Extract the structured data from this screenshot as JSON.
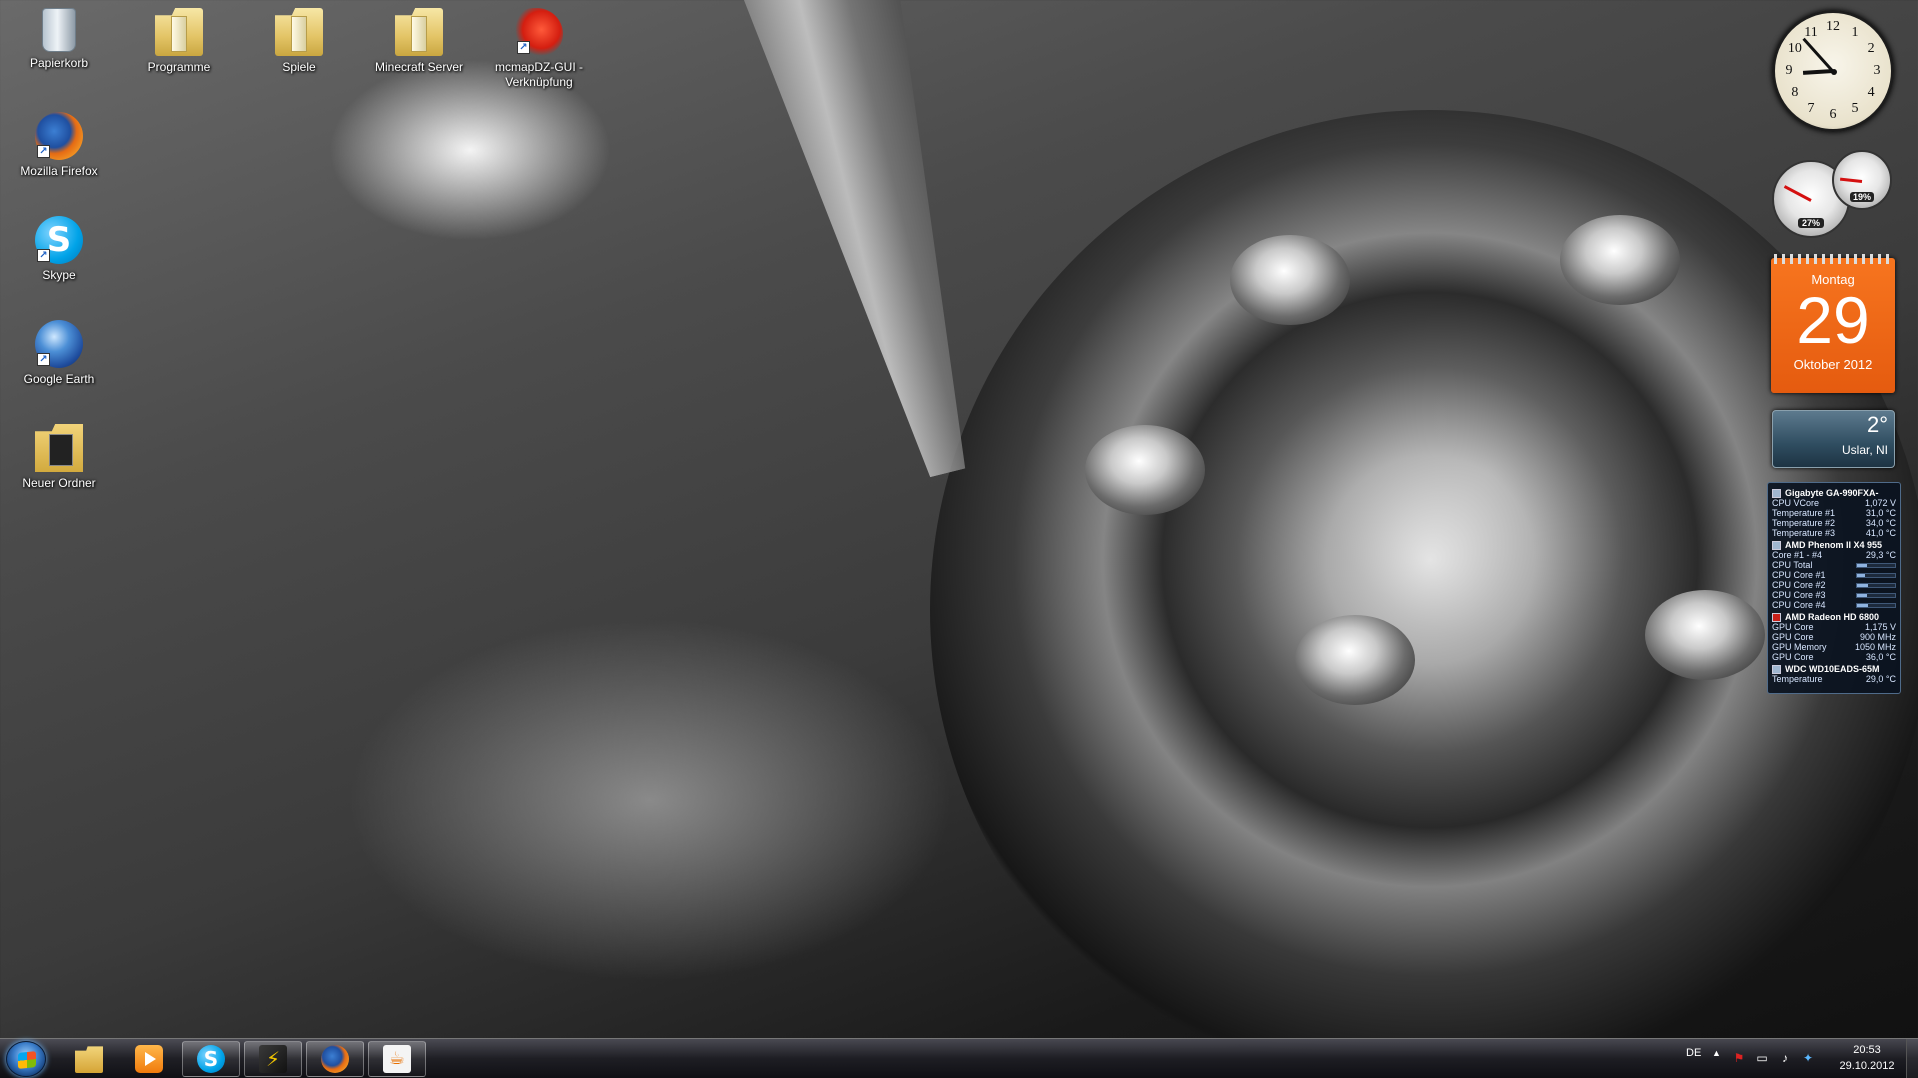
{
  "desktop": {
    "icons": [
      {
        "label": "Papierkorb",
        "icon": "recycle-bin-icon"
      },
      {
        "label": "Programme",
        "icon": "folder-icon"
      },
      {
        "label": "Spiele",
        "icon": "folder-icon"
      },
      {
        "label": "Minecraft Server",
        "icon": "folder-icon"
      },
      {
        "label": "mcmapDZ-GUI - Verknüpfung",
        "icon": "dragon-app-icon"
      },
      {
        "label": "Mozilla Firefox",
        "icon": "firefox-icon"
      },
      {
        "label": "Skype",
        "icon": "skype-icon"
      },
      {
        "label": "Google Earth",
        "icon": "google-earth-icon"
      },
      {
        "label": "Neuer Ordner",
        "icon": "folder-icon"
      }
    ]
  },
  "gadgets": {
    "clock": {
      "numerals": [
        "12",
        "1",
        "2",
        "3",
        "4",
        "5",
        "6",
        "7",
        "8",
        "9",
        "10",
        "11"
      ],
      "hour": 8,
      "minute": 53
    },
    "cpu_meter": {
      "cpu_percent": "27%",
      "memory_percent": "19%",
      "cpu_level": 0.27,
      "memory_level": 0.19
    },
    "calendar": {
      "weekday": "Montag",
      "day": "29",
      "month_year": "Oktober 2012"
    },
    "weather": {
      "temperature": "2°",
      "location": "Uslar, NI"
    },
    "hardware_monitor": {
      "groups": [
        {
          "name": "Gigabyte GA-990FXA-",
          "vendor": "board",
          "rows": [
            {
              "label": "CPU VCore",
              "value": "1,072 V"
            },
            {
              "label": "Temperature #1",
              "value": "31,0 °C"
            },
            {
              "label": "Temperature #2",
              "value": "34,0 °C"
            },
            {
              "label": "Temperature #3",
              "value": "41,0 °C"
            }
          ]
        },
        {
          "name": "AMD Phenom II X4 955",
          "vendor": "cpu",
          "rows": [
            {
              "label": "Core #1 - #4",
              "value": "29,3 °C"
            },
            {
              "label": "CPU Total",
              "bar": 0.27
            },
            {
              "label": "CPU Core #1",
              "bar": 0.22
            },
            {
              "label": "CPU Core #2",
              "bar": 0.3
            },
            {
              "label": "CPU Core #3",
              "bar": 0.25
            },
            {
              "label": "CPU Core #4",
              "bar": 0.28
            }
          ]
        },
        {
          "name": "AMD Radeon HD 6800",
          "vendor": "amd",
          "rows": [
            {
              "label": "GPU Core",
              "value": "1,175 V"
            },
            {
              "label": "GPU Core",
              "value": "900 MHz"
            },
            {
              "label": "GPU Memory",
              "value": "1050 MHz"
            },
            {
              "label": "GPU Core",
              "value": "36,0 °C"
            }
          ]
        },
        {
          "name": "WDC WD10EADS-65M",
          "vendor": "disk",
          "rows": [
            {
              "label": "Temperature",
              "value": "29,0 °C"
            }
          ]
        }
      ]
    }
  },
  "taskbar": {
    "pinned": [
      {
        "name": "windows-explorer",
        "icon": "folder-icon",
        "open": false
      },
      {
        "name": "windows-media-player",
        "icon": "media-player-icon",
        "open": false
      },
      {
        "name": "skype",
        "icon": "skype-icon",
        "glyph": "S",
        "open": true
      },
      {
        "name": "winamp",
        "icon": "winamp-icon",
        "glyph": "⚡",
        "open": true
      },
      {
        "name": "firefox",
        "icon": "firefox-icon",
        "open": true
      },
      {
        "name": "java",
        "icon": "java-icon",
        "glyph": "☕",
        "open": true
      }
    ],
    "tray": {
      "language": "DE",
      "time": "20:53",
      "date": "29.10.2012"
    }
  }
}
